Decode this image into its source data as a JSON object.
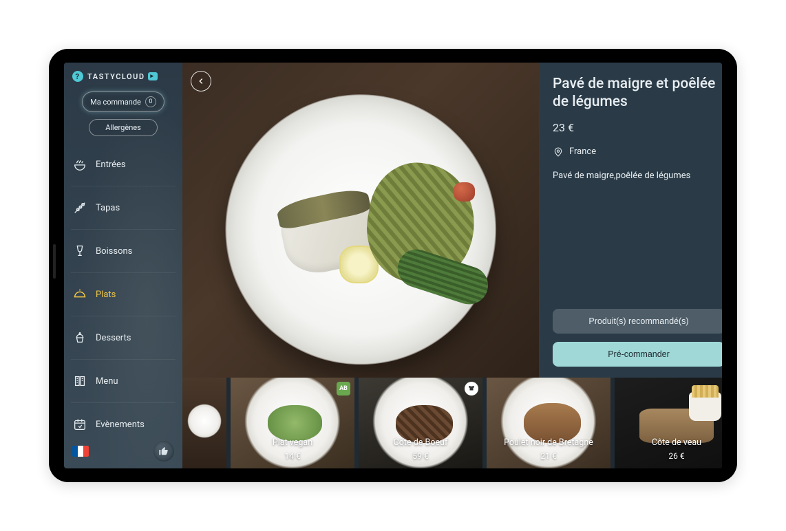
{
  "brand": "TASTYCLOUD",
  "order_pill": {
    "label": "Ma commande",
    "count": "0"
  },
  "allergens_label": "Allergènes",
  "nav": [
    {
      "icon": "bowl",
      "label": "Entrées"
    },
    {
      "icon": "skewer",
      "label": "Tapas"
    },
    {
      "icon": "glass",
      "label": "Boissons"
    },
    {
      "icon": "cloche",
      "label": "Plats",
      "active": true
    },
    {
      "icon": "cupcake",
      "label": "Desserts"
    },
    {
      "icon": "menu",
      "label": "Menu"
    },
    {
      "icon": "calendar",
      "label": "Evènements"
    }
  ],
  "dish": {
    "title": "Pavé de maigre et poêlée de légumes",
    "price": "23 €",
    "origin": "France",
    "description": "Pavé de maigre,poêlée de légumes"
  },
  "actions": {
    "recommended": "Produit(s) recommandé(s)",
    "preorder": "Pré-commander"
  },
  "thumbs": [
    {
      "name": "",
      "price": ""
    },
    {
      "name": "Plat vegan",
      "price": "14 €",
      "badge": "AB"
    },
    {
      "name": "Côte de Boeuf",
      "price": "59 €",
      "badge": "chef"
    },
    {
      "name": "Poulet noir de Bretagne",
      "price": "21 €"
    },
    {
      "name": "Côte de veau",
      "price": "26 €"
    }
  ],
  "colors": {
    "accent": "#f2c744",
    "primary_btn": "#9fd8d6",
    "panel": "#2a3b47"
  }
}
